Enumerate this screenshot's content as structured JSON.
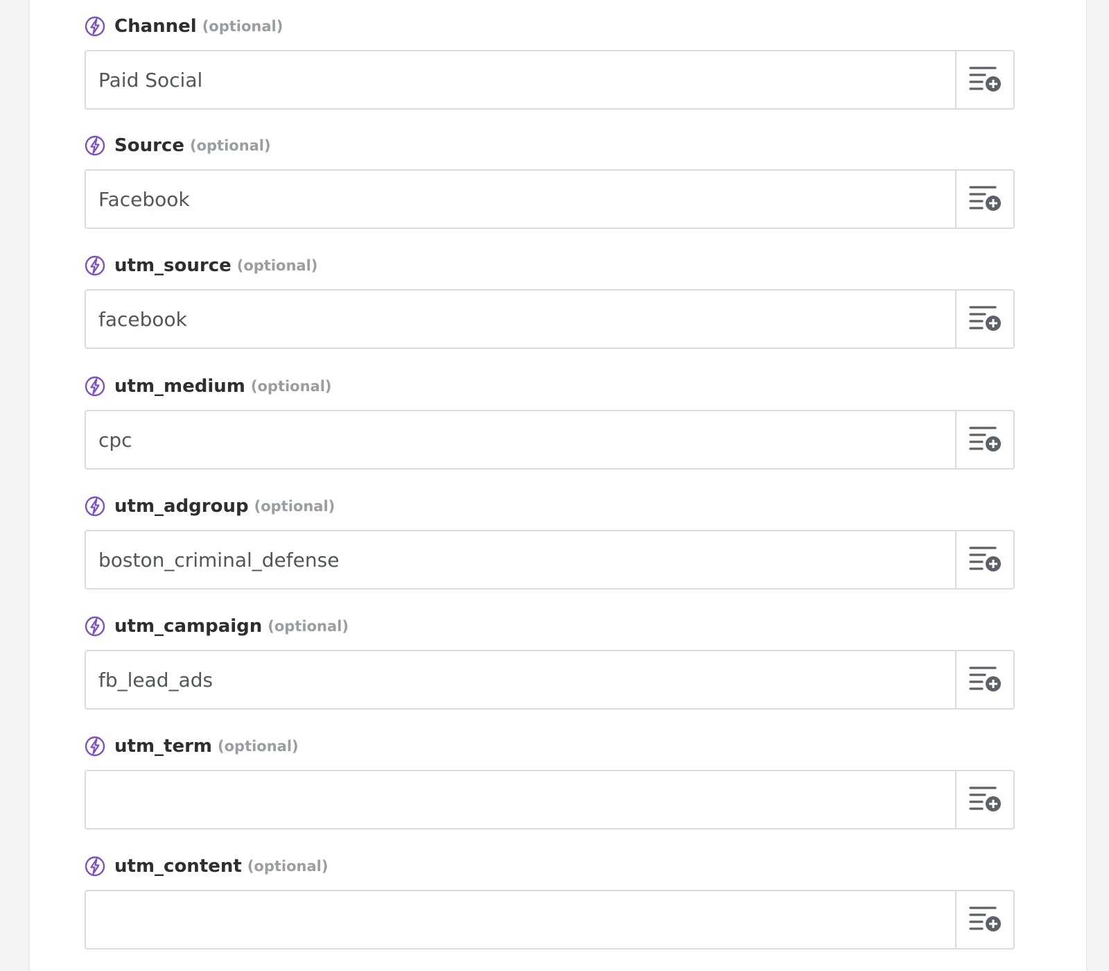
{
  "form": {
    "optional_text": "(optional)",
    "icons": {
      "field_marker": "lightning-bolt-icon",
      "insert_data": "list-plus-icon"
    },
    "colors": {
      "accent": "#7b4fc9",
      "label": "#2d2e2e",
      "optional": "#999ea2",
      "value": "#505659",
      "border": "#d9dcde"
    },
    "fields": [
      {
        "label": "Channel",
        "value": "Paid Social"
      },
      {
        "label": "Source",
        "value": "Facebook"
      },
      {
        "label": "utm_source",
        "value": "facebook"
      },
      {
        "label": "utm_medium",
        "value": "cpc"
      },
      {
        "label": "utm_adgroup",
        "value": "boston_criminal_defense"
      },
      {
        "label": "utm_campaign",
        "value": "fb_lead_ads"
      },
      {
        "label": "utm_term",
        "value": ""
      },
      {
        "label": "utm_content",
        "value": ""
      }
    ]
  }
}
